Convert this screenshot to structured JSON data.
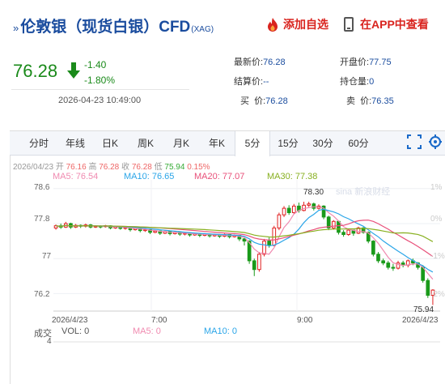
{
  "header": {
    "title": "伦敦银（现货白银）CFD",
    "title_sub": "(XAG)",
    "add_favorite": "添加自选",
    "view_in_app": "在APP中查看"
  },
  "price": {
    "last": "76.28",
    "change": "-1.40",
    "change_pct": "-1.80%",
    "datetime": "2026-04-23 10:49:00"
  },
  "quote": {
    "latest_label": "最新价:",
    "latest": "76.28",
    "open_label": "开盘价:",
    "open": "77.75",
    "settle_label": "结算价:",
    "settle": "--",
    "position_label": "持仓量:",
    "position": "0",
    "buy_label": "买  价:",
    "buy": "76.28",
    "sell_label": "卖  价:",
    "sell": "76.35"
  },
  "tabs": [
    "分时",
    "年线",
    "日K",
    "周K",
    "月K",
    "年K",
    "5分",
    "15分",
    "30分",
    "60分"
  ],
  "active_tab": "5分",
  "ohlc": {
    "date": "2026/04/23",
    "open_label": "开",
    "open": "76.16",
    "high_label": "高",
    "high": "76.28",
    "close_label": "收",
    "close": "76.28",
    "low_label": "低",
    "low": "75.94",
    "pct": "0.15%"
  },
  "ma": {
    "ma5": "MA5: 76.54",
    "ma10": "MA10: 76.65",
    "ma20": "MA20: 77.07",
    "ma30": "MA30: 77.38"
  },
  "volume": {
    "label": "成交",
    "vol": "VOL: 0",
    "ma5": "MA5: 0",
    "ma10": "MA10: 0",
    "axis": "4"
  },
  "axis": {
    "y_ticks": [
      "78.6",
      "77.8",
      "77",
      "76.2"
    ],
    "y_right": [
      "1%",
      "0%",
      "-1%",
      "-2%"
    ],
    "x_labels": [
      "2026/4/23",
      "7:00",
      "9:00",
      "2026/4/23"
    ],
    "high_label": "78.30",
    "low_label": "75.94"
  },
  "watermark": "sina 新浪财经",
  "colors": {
    "up": "#e02020",
    "down": "#1a9a1a",
    "ma5": "#f08ab0",
    "ma10": "#2aa5e8",
    "ma20": "#e8507a",
    "ma30": "#88b020",
    "title": "#1a4c9e"
  },
  "chart_data": {
    "type": "candlestick",
    "ylim": [
      75.8,
      78.8
    ],
    "candles": [
      [
        77.7,
        77.75,
        77.78,
        77.66
      ],
      [
        77.75,
        77.72,
        77.8,
        77.68
      ],
      [
        77.72,
        77.8,
        77.84,
        77.7
      ],
      [
        77.8,
        77.72,
        77.82,
        77.68
      ],
      [
        77.72,
        77.76,
        77.79,
        77.7
      ],
      [
        77.76,
        77.74,
        77.78,
        77.7
      ],
      [
        77.74,
        77.77,
        77.8,
        77.71
      ],
      [
        77.77,
        77.72,
        77.79,
        77.69
      ],
      [
        77.72,
        77.74,
        77.76,
        77.7
      ],
      [
        77.74,
        77.73,
        77.76,
        77.69
      ],
      [
        77.73,
        77.75,
        77.77,
        77.71
      ],
      [
        77.75,
        77.7,
        77.76,
        77.67
      ],
      [
        77.7,
        77.73,
        77.75,
        77.68
      ],
      [
        77.73,
        77.69,
        77.74,
        77.66
      ],
      [
        77.69,
        77.71,
        77.73,
        77.66
      ],
      [
        77.71,
        77.66,
        77.72,
        77.62
      ],
      [
        77.66,
        77.69,
        77.71,
        77.64
      ],
      [
        77.69,
        77.64,
        77.7,
        77.6
      ],
      [
        77.64,
        77.66,
        77.68,
        77.61
      ],
      [
        77.66,
        77.6,
        77.67,
        77.56
      ],
      [
        77.6,
        77.63,
        77.65,
        77.58
      ],
      [
        77.63,
        77.58,
        77.64,
        77.54
      ],
      [
        77.58,
        77.62,
        77.64,
        77.56
      ],
      [
        77.62,
        77.57,
        77.63,
        77.53
      ],
      [
        77.57,
        77.6,
        77.62,
        77.55
      ],
      [
        77.6,
        77.56,
        77.61,
        77.52
      ],
      [
        77.56,
        77.58,
        77.6,
        77.53
      ],
      [
        77.58,
        77.54,
        77.59,
        77.5
      ],
      [
        77.54,
        77.57,
        77.59,
        77.52
      ],
      [
        77.57,
        77.53,
        77.58,
        77.49
      ],
      [
        77.53,
        77.56,
        77.58,
        77.51
      ],
      [
        77.56,
        77.52,
        77.57,
        77.48
      ],
      [
        77.52,
        77.55,
        77.57,
        77.5
      ],
      [
        77.55,
        77.51,
        77.56,
        77.47
      ],
      [
        77.51,
        77.55,
        77.57,
        77.49
      ],
      [
        77.55,
        77.5,
        77.56,
        77.46
      ],
      [
        77.5,
        77.53,
        77.55,
        77.48
      ],
      [
        77.53,
        77.45,
        77.54,
        77.4
      ],
      [
        77.45,
        77.4,
        77.47,
        77.3
      ],
      [
        77.4,
        76.95,
        77.42,
        76.88
      ],
      [
        76.95,
        76.75,
        77.0,
        76.6
      ],
      [
        76.75,
        77.1,
        77.15,
        76.7
      ],
      [
        77.1,
        77.4,
        77.45,
        77.05
      ],
      [
        77.4,
        77.3,
        77.48,
        77.25
      ],
      [
        77.3,
        77.7,
        77.75,
        77.28
      ],
      [
        77.7,
        78.0,
        78.05,
        77.65
      ],
      [
        78.0,
        78.15,
        78.2,
        77.95
      ],
      [
        78.15,
        78.05,
        78.22,
        78.0
      ],
      [
        78.05,
        78.2,
        78.25,
        78.02
      ],
      [
        78.2,
        78.1,
        78.28,
        78.05
      ],
      [
        78.1,
        78.22,
        78.3,
        78.08
      ],
      [
        78.22,
        78.25,
        78.3,
        78.18
      ],
      [
        78.25,
        78.15,
        78.28,
        78.1
      ],
      [
        78.15,
        78.2,
        78.24,
        78.12
      ],
      [
        78.2,
        77.95,
        78.22,
        77.9
      ],
      [
        77.95,
        77.7,
        77.98,
        77.65
      ],
      [
        77.7,
        77.85,
        77.88,
        77.66
      ],
      [
        77.85,
        77.6,
        77.86,
        77.55
      ],
      [
        77.6,
        77.55,
        77.65,
        77.5
      ],
      [
        77.55,
        77.65,
        77.68,
        77.52
      ],
      [
        77.65,
        77.58,
        77.66,
        77.52
      ],
      [
        77.58,
        77.7,
        77.73,
        77.56
      ],
      [
        77.7,
        77.6,
        77.72,
        77.57
      ],
      [
        77.6,
        77.4,
        77.62,
        77.35
      ],
      [
        77.4,
        77.1,
        77.42,
        77.05
      ],
      [
        77.1,
        76.95,
        77.15,
        76.9
      ],
      [
        76.95,
        76.9,
        77.0,
        76.85
      ],
      [
        76.9,
        76.8,
        76.95,
        76.75
      ],
      [
        76.8,
        76.78,
        76.88,
        76.72
      ],
      [
        76.78,
        76.9,
        76.95,
        76.75
      ],
      [
        76.9,
        76.85,
        76.95,
        76.8
      ],
      [
        76.85,
        76.95,
        76.98,
        76.8
      ],
      [
        76.95,
        76.9,
        77.0,
        76.85
      ],
      [
        76.9,
        76.8,
        76.92,
        76.75
      ],
      [
        76.8,
        76.5,
        76.85,
        76.45
      ],
      [
        76.5,
        76.16,
        76.55,
        76.1
      ],
      [
        76.16,
        76.28,
        76.3,
        75.94
      ]
    ]
  }
}
